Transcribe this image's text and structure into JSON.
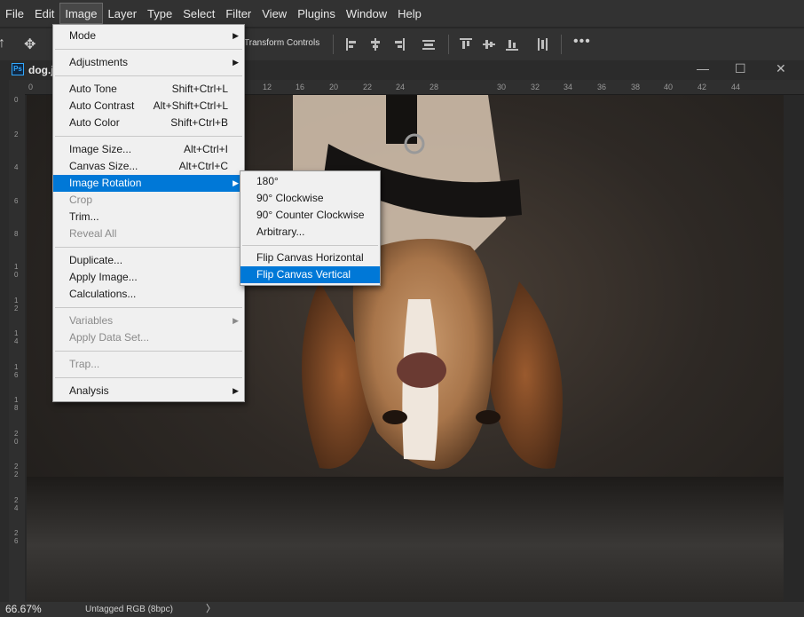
{
  "menubar": [
    "File",
    "Edit",
    "Image",
    "Layer",
    "Type",
    "Select",
    "Filter",
    "View",
    "Plugins",
    "Window",
    "Help"
  ],
  "options_bar": {
    "move_icon": "move-tool-icon",
    "transform_label": "Transform Controls",
    "more_icon": "more-options-icon"
  },
  "document": {
    "title": "dog.j",
    "app_icon_text": "Ps"
  },
  "ruler": {
    "h_ticks": [
      "0",
      "12",
      "16",
      "20",
      "22",
      "24",
      "28",
      "30",
      "32",
      "34",
      "36",
      "38",
      "40",
      "42",
      "44"
    ],
    "v_ticks": [
      "0",
      "2",
      "4",
      "6",
      "8",
      "1 0",
      "1 2",
      "1 4",
      "1 6",
      "1 8",
      "2 0",
      "2 2",
      "2 4",
      "2 6"
    ]
  },
  "image_menu": {
    "sections": [
      [
        {
          "label": "Mode",
          "submenu": true
        }
      ],
      [
        {
          "label": "Adjustments",
          "submenu": true
        }
      ],
      [
        {
          "label": "Auto Tone",
          "shortcut": "Shift+Ctrl+L"
        },
        {
          "label": "Auto Contrast",
          "shortcut": "Alt+Shift+Ctrl+L"
        },
        {
          "label": "Auto Color",
          "shortcut": "Shift+Ctrl+B"
        }
      ],
      [
        {
          "label": "Image Size...",
          "shortcut": "Alt+Ctrl+I"
        },
        {
          "label": "Canvas Size...",
          "shortcut": "Alt+Ctrl+C"
        },
        {
          "label": "Image Rotation",
          "submenu": true,
          "highlighted": true
        },
        {
          "label": "Crop",
          "disabled": true
        },
        {
          "label": "Trim..."
        },
        {
          "label": "Reveal All",
          "disabled": true
        }
      ],
      [
        {
          "label": "Duplicate..."
        },
        {
          "label": "Apply Image..."
        },
        {
          "label": "Calculations..."
        }
      ],
      [
        {
          "label": "Variables",
          "submenu": true,
          "disabled": true
        },
        {
          "label": "Apply Data Set...",
          "disabled": true
        }
      ],
      [
        {
          "label": "Trap...",
          "disabled": true
        }
      ],
      [
        {
          "label": "Analysis",
          "submenu": true
        }
      ]
    ]
  },
  "rotation_submenu": {
    "sections": [
      [
        {
          "label": "180°"
        },
        {
          "label": "90° Clockwise"
        },
        {
          "label": "90° Counter Clockwise"
        },
        {
          "label": "Arbitrary..."
        }
      ],
      [
        {
          "label": "Flip Canvas Horizontal"
        },
        {
          "label": "Flip Canvas Vertical",
          "highlighted": true
        }
      ]
    ]
  },
  "status": {
    "zoom": "66.67%",
    "profile": "Untagged RGB (8bpc)",
    "arrow": "〉"
  },
  "colors": {
    "highlight": "#0078d7",
    "menu_bg": "#f0f0f0",
    "app_bg": "#323232"
  }
}
